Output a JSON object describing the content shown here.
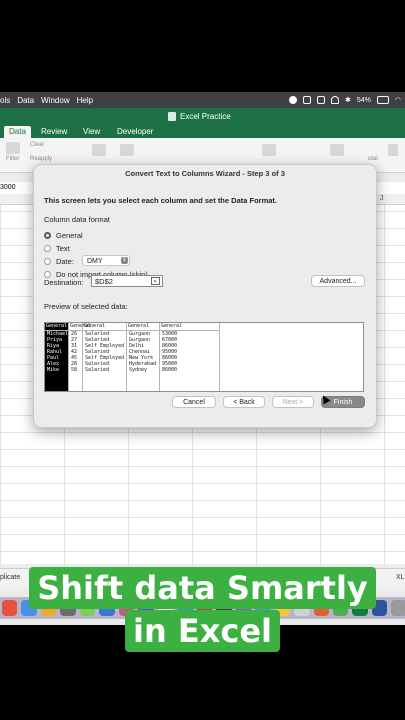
{
  "menubar": {
    "items": [
      "ols",
      "Data",
      "Window",
      "Help"
    ],
    "battery": "54%"
  },
  "app": {
    "title": "Excel Practice",
    "tabs": [
      "Data",
      "Review",
      "View",
      "Developer"
    ],
    "ribbon": {
      "clear": "Clear",
      "reapply": "Reapply",
      "filter": "Filter",
      "total": "otal"
    },
    "name_box": "3000",
    "column_j": "J",
    "sheet_tabs": {
      "left": "plicate",
      "right1": "UP",
      "right2": "XL"
    }
  },
  "dialog": {
    "title": "Convert Text to Columns Wizard - Step 3 of 3",
    "instruction": "This screen lets you select each column and set the Data Format.",
    "column_format_label": "Column data format",
    "formats": [
      "General",
      "Text",
      "Date:",
      "Do not import column (skip)"
    ],
    "selected_format": "General",
    "date_format": "DMY",
    "destination_label": "Destination:",
    "destination_value": "$D$2",
    "advanced_button": "Advanced...",
    "preview_label": "Preview of selected data:",
    "preview": {
      "headers": [
        "General",
        "General",
        "General",
        "General",
        "General"
      ],
      "columns": [
        [
          "Michael",
          "Priya",
          "Riya",
          "Rahul",
          "Paul",
          "Alex",
          "Mike"
        ],
        [
          "26",
          "27",
          "31",
          "42",
          "45",
          "28",
          "58"
        ],
        [
          "Salaried",
          "Salaried",
          "Self Employed",
          "Salaried",
          "Self Employed",
          "Salaried",
          "Salaried"
        ],
        [
          "Gurgaon",
          "Gurgaon",
          "Delhi",
          "Chennai",
          "New York",
          "Hyderabad",
          "Sydney"
        ],
        [
          "53000",
          "67000",
          "86000",
          "95000",
          "86000",
          "95000",
          "86000"
        ]
      ],
      "selected_column": 0
    },
    "buttons": {
      "cancel": "Cancel",
      "back": "< Back",
      "next": "Next >",
      "finish": "Finish"
    }
  },
  "caption": {
    "line1": "Shift data Smartly",
    "line2": "in Excel",
    "color": "#3db042"
  }
}
